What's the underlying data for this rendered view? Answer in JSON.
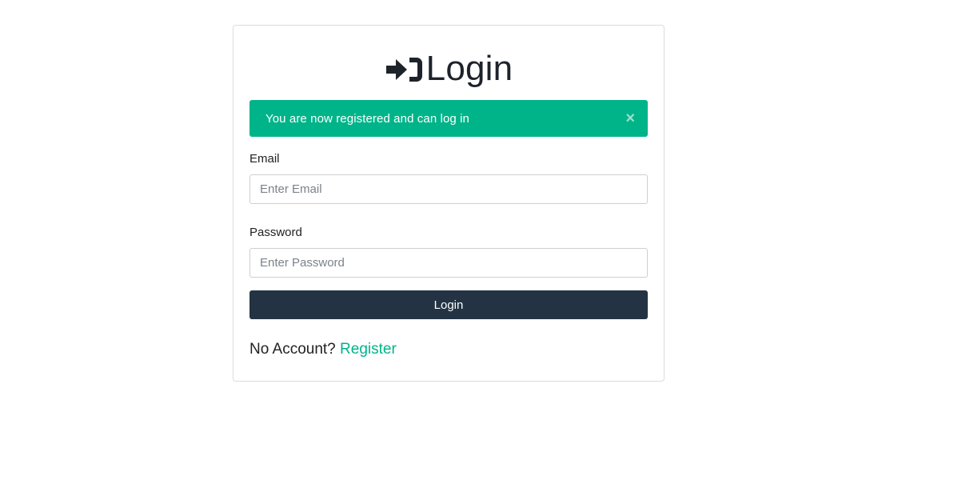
{
  "heading": {
    "icon": "sign-in-icon",
    "title": "Login"
  },
  "alert": {
    "message": "You are now registered and can log in",
    "close_glyph": "×",
    "color": "#00b48a"
  },
  "form": {
    "email": {
      "label": "Email",
      "placeholder": "Enter Email",
      "value": ""
    },
    "password": {
      "label": "Password",
      "placeholder": "Enter Password",
      "value": ""
    },
    "submit_label": "Login",
    "submit_color": "#233343"
  },
  "footer": {
    "prompt": "No Account?",
    "link_label": "Register",
    "link_color": "#00b48a"
  }
}
